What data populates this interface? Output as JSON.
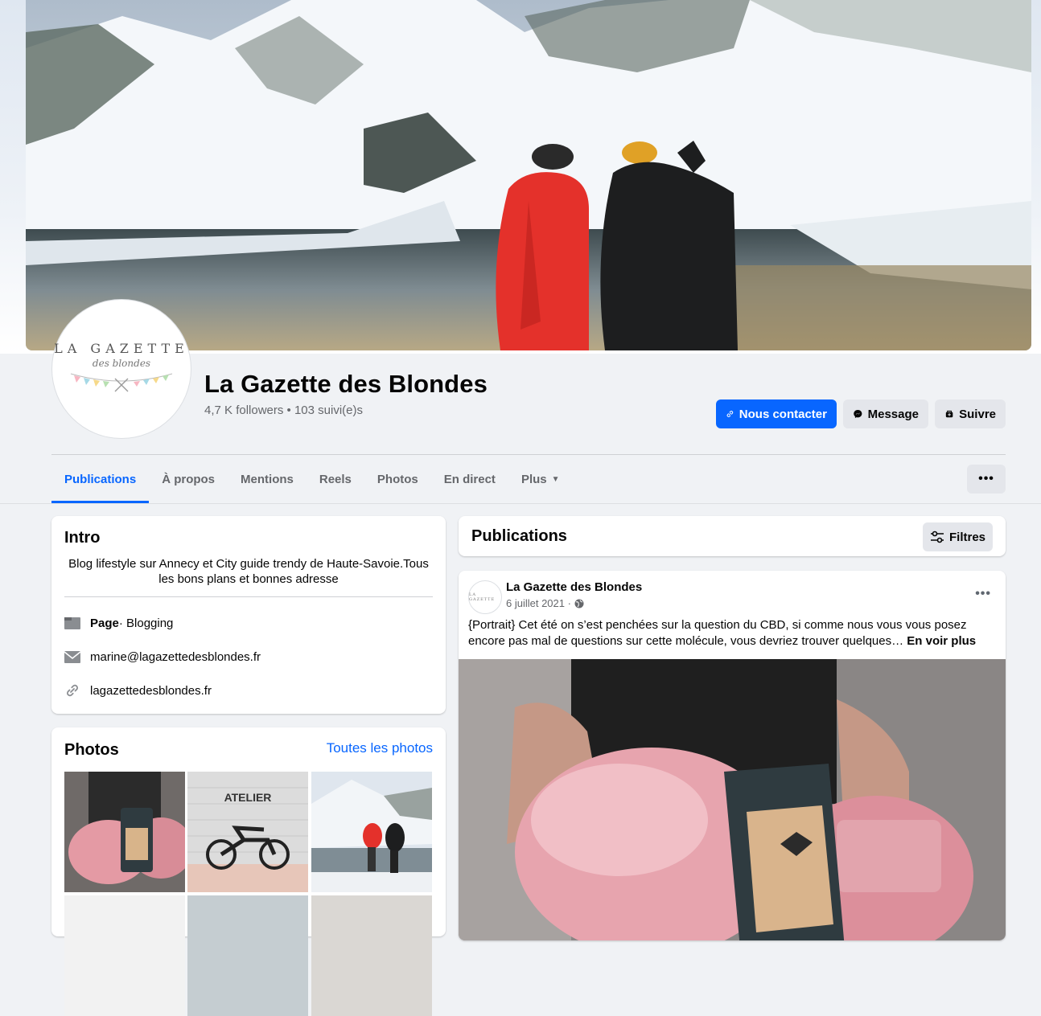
{
  "page": {
    "name": "La Gazette des Blondes",
    "stats": "4,7 K followers • 103 suivi(e)s",
    "logo_line1": "LA GAZETTE",
    "logo_line2": "des blondes"
  },
  "actions": {
    "contact": "Nous contacter",
    "message": "Message",
    "follow": "Suivre"
  },
  "tabs": [
    {
      "label": "Publications",
      "active": true
    },
    {
      "label": "À propos"
    },
    {
      "label": "Mentions"
    },
    {
      "label": "Reels"
    },
    {
      "label": "Photos"
    },
    {
      "label": "En direct"
    },
    {
      "label": "Plus"
    }
  ],
  "more_button": "•••",
  "intro": {
    "title": "Intro",
    "bio": "Blog lifestyle sur Annecy et City guide trendy de Haute-Savoie.Tous les bons plans et bonnes adresse",
    "category_label": "Page",
    "category_value": " · Blogging",
    "email": "marine@lagazettedesblondes.fr",
    "website": "lagazettedesblondes.fr"
  },
  "photos": {
    "title": "Photos",
    "all_link": "Toutes les photos",
    "thumb2_text": "ATELIER"
  },
  "publications": {
    "title": "Publications",
    "filters": "Filtres"
  },
  "post": {
    "author": "La Gazette des Blondes",
    "date": "6 juillet 2021 ·",
    "text": "{Portrait} Cet été on s’est penchées sur la question du CBD, si comme nous vous vous posez encore pas mal de questions sur cette molécule, vous devriez trouver quelques…",
    "see_more": "En voir plus",
    "options": "•••",
    "avatar_text": "LA GAZETTE"
  },
  "icons": {
    "contact": "link-icon",
    "message": "messenger-icon",
    "follow": "follow-icon",
    "filters": "sliders-icon",
    "category": "page-flag-icon",
    "email": "envelope-icon",
    "website": "link-icon",
    "audience": "globe-icon"
  },
  "colors": {
    "accent": "#0866ff",
    "grey_button": "#e4e6eb",
    "secondary_text": "#65676b"
  }
}
